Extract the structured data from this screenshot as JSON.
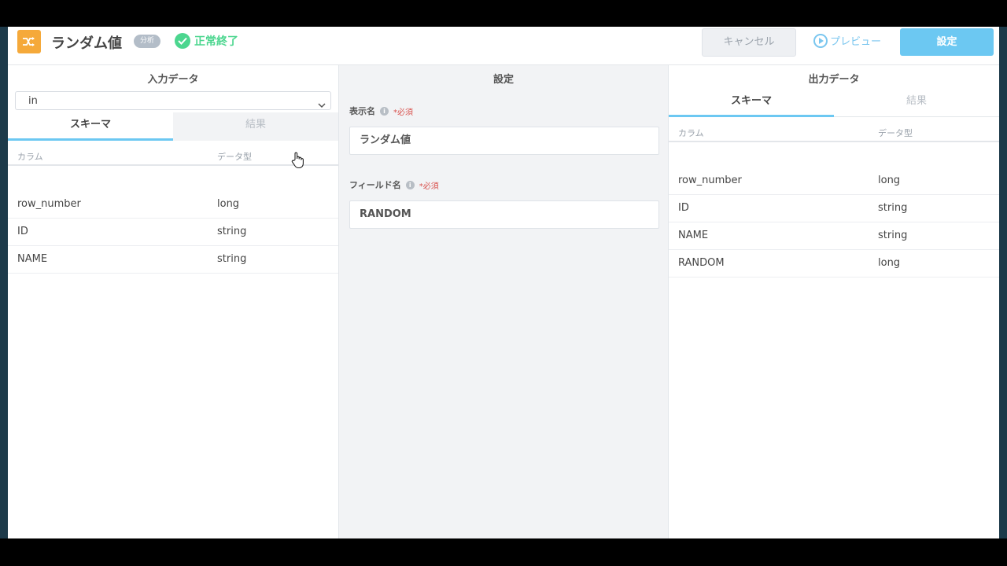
{
  "header": {
    "title": "ランダム値",
    "category": "分析",
    "status": "正常終了",
    "cancel_label": "キャンセル",
    "preview_label": "プレビュー",
    "save_label": "設定",
    "node_icon": "shuffle-icon",
    "accent_color": "#6cc8f2",
    "status_color": "#4cd68f"
  },
  "input_panel": {
    "title": "入力データ",
    "select_value": "in",
    "tabs": [
      {
        "label": "スキーマ",
        "active": true
      },
      {
        "label": "結果",
        "active": false
      }
    ],
    "columns": [
      "カラム",
      "データ型"
    ],
    "rows": [
      {
        "name": "row_number",
        "type": "long"
      },
      {
        "name": "ID",
        "type": "string"
      },
      {
        "name": "NAME",
        "type": "string"
      }
    ]
  },
  "settings_panel": {
    "title": "設定",
    "fields": [
      {
        "label": "表示名",
        "required": "*必須",
        "value": "ランダム値"
      },
      {
        "label": "フィールド名",
        "required": "*必須",
        "value": "RANDOM"
      }
    ]
  },
  "output_panel": {
    "title": "出力データ",
    "tabs": [
      {
        "label": "スキーマ",
        "active": true
      },
      {
        "label": "結果",
        "active": false
      }
    ],
    "columns": [
      "カラム",
      "データ型"
    ],
    "rows": [
      {
        "name": "row_number",
        "type": "long"
      },
      {
        "name": "ID",
        "type": "string"
      },
      {
        "name": "NAME",
        "type": "string"
      },
      {
        "name": "RANDOM",
        "type": "long"
      }
    ]
  }
}
